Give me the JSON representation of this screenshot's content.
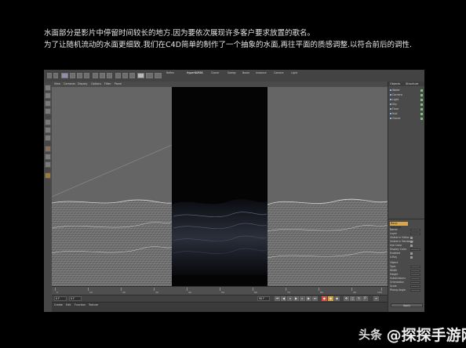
{
  "caption": {
    "line1": "水面部分是影片中停留时间较长的地方.因为要依次展现许多客户要求放置的歌名。",
    "line2": "为了让随机流动的水面更细致.我们在C4D简单的制作了一个抽象的水面,再往平面的质感调整.以符合前后的调性."
  },
  "toolbar": {
    "labels": [
      "Reflex",
      "HyperNURBS",
      "Cloner",
      "Sweep",
      "Boole",
      "Instance",
      "Camera",
      "Light"
    ],
    "highlight_color": "#8e8eb0"
  },
  "viewport_menu": [
    "View",
    "Cameras",
    "Display",
    "Options",
    "Filter",
    "Panel"
  ],
  "right_panel": {
    "tabs": [
      "Objects",
      "Structure"
    ],
    "objects": [
      "Water",
      "Camera",
      "Light",
      "Sky",
      "Floor",
      "Null",
      "Cloner"
    ],
    "attr_tab": "Basic Settings",
    "attributes": [
      "Name",
      "Layer",
      "Visible in Editor",
      "Visible in Renderer",
      "Use Color",
      "Display Color",
      "Enabled",
      "X-Ray",
      "Object",
      "Type",
      "Width",
      "Height",
      "Subdivisions",
      "Orientation",
      "Scale",
      "Phong Angle"
    ],
    "bottom_button": "Apply"
  },
  "timeline": {
    "ticks": [
      "0",
      "10",
      "20",
      "30",
      "40",
      "50",
      "60",
      "70",
      "80",
      "90",
      "100"
    ],
    "frame_start": "0 F",
    "frame_end": "90 F",
    "current_frame": "0 F"
  },
  "material_menu": [
    "Create",
    "Edit",
    "Function",
    "Texture"
  ],
  "watermark": {
    "small": "头条",
    "big": "@探探手游网"
  },
  "colors": {
    "wire": "#b0b0b0",
    "water": "#0a0c12",
    "accent": "#d9a64a"
  }
}
